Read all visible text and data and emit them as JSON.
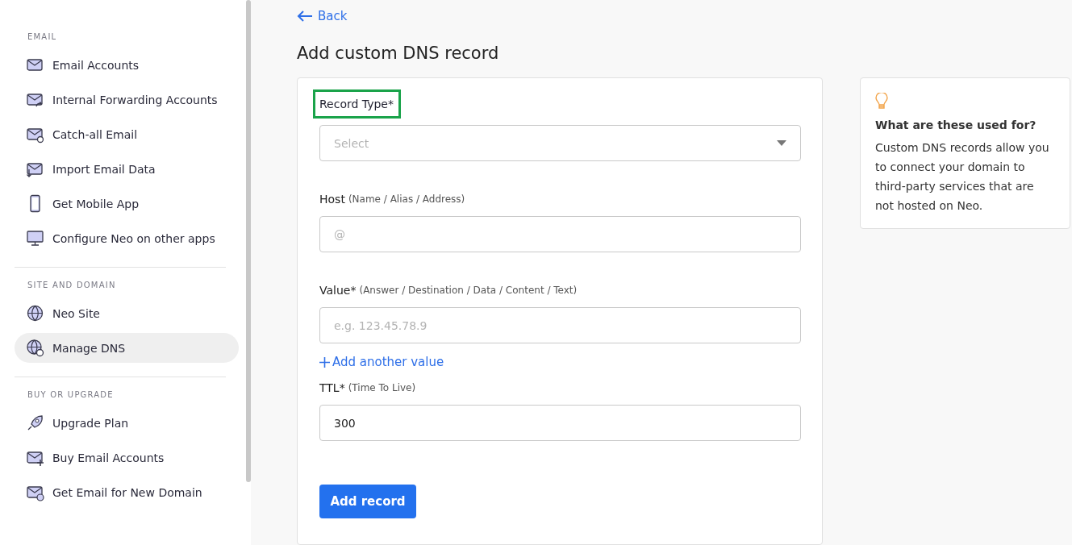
{
  "sidebar": {
    "sections": [
      {
        "title": "EMAIL",
        "items": [
          {
            "label": "Email Accounts",
            "selected": false
          },
          {
            "label": "Internal Forwarding Accounts",
            "selected": false
          },
          {
            "label": "Catch-all Email",
            "selected": false
          },
          {
            "label": "Import Email Data",
            "selected": false
          },
          {
            "label": "Get Mobile App",
            "selected": false
          },
          {
            "label": "Configure Neo on other apps",
            "selected": false
          }
        ]
      },
      {
        "title": "SITE AND DOMAIN",
        "items": [
          {
            "label": "Neo Site",
            "selected": false
          },
          {
            "label": "Manage DNS",
            "selected": true
          }
        ]
      },
      {
        "title": "BUY OR UPGRADE",
        "items": [
          {
            "label": "Upgrade Plan",
            "selected": false
          },
          {
            "label": "Buy Email Accounts",
            "selected": false
          },
          {
            "label": "Get Email for New Domain",
            "selected": false
          }
        ]
      }
    ]
  },
  "back_link": "Back",
  "page_title": "Add custom DNS record",
  "form": {
    "fields": [
      {
        "kind": "select",
        "label": "Record Type*",
        "highlighted": true,
        "placeholder": "Select"
      },
      {
        "kind": "text",
        "label": "Host",
        "hint": "(Name / Alias / Address)",
        "highlighted": false,
        "placeholder": "@"
      },
      {
        "kind": "text",
        "label": "Value*",
        "hint": "(Answer / Destination / Data / Content / Text)",
        "highlighted": false,
        "placeholder": "e.g. 123.45.78.9",
        "add_link": "Add another value"
      },
      {
        "kind": "text",
        "label": "TTL*",
        "hint": "(Time To Live)",
        "highlighted": false,
        "value": "300"
      }
    ],
    "submit": "Add record"
  },
  "info": {
    "title": "What are these used for?",
    "text": "Custom DNS records allow you to connect your domain to third-party services that are not hosted on Neo."
  }
}
